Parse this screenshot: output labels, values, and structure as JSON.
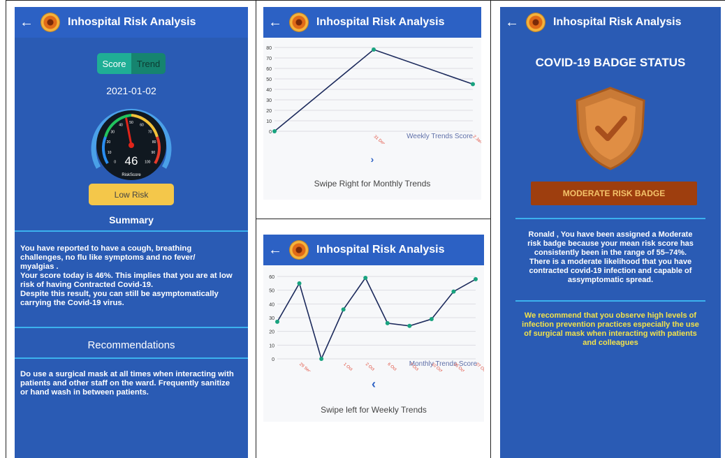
{
  "app_title": "Inhospital Risk Analysis",
  "back_icon": "arrow-left-icon",
  "score_panel": {
    "tabs": [
      "Score",
      "Trend"
    ],
    "date": "2021-01-02",
    "gauge": {
      "value": "46",
      "caption": "RiskScore",
      "max": 100,
      "ticks": [
        "0",
        "10",
        "20",
        "30",
        "40",
        "50",
        "60",
        "70",
        "80",
        "90",
        "100"
      ]
    },
    "risk_label": "Low Risk",
    "summary_title": "Summary",
    "summary_lines": [
      "You have reported to have a cough, breathing",
      "challenges, no flu like symptoms and no fever/",
      "myalgias .",
      "Your score today is 46%. This implies that you are at low",
      "risk of having Contracted Covid-19.",
      "Despite this result, you can still be asymptomatically",
      "carrying the Covid-19 virus."
    ],
    "recommendations_title": "Recommendations",
    "recommendation_lines": [
      "Do use a surgical mask at all times when interacting with",
      "patients and other staff on the ward. Frequently sanitize",
      "or hand wash in between patients."
    ]
  },
  "weekly_panel": {
    "chart_label": "Weekly Trends Score",
    "swipe_hint": "Swipe Right for Monthly Trends",
    "chevron_icon": "chevron-right-icon"
  },
  "monthly_panel": {
    "chart_label": "Monthly Trends Score",
    "swipe_hint": "Swipe left for Weekly Trends",
    "chevron_icon": "chevron-left-icon"
  },
  "badge_panel": {
    "title": "COVID-19 BADGE STATUS",
    "badge_icon": "shield-check-icon",
    "badge_label": "MODERATE RISK BADGE",
    "explanation_lines": [
      "Ronald , You have been assigned a Moderate",
      "risk badge because your mean risk score has",
      "consistently been in the range of 55–74%.",
      "There is a moderate likelihood that you have",
      "contracted covid-19 infection and capable of",
      "assymptomatic spread."
    ],
    "advice_lines": [
      "We recommend that you observe high levels of",
      "infection prevention practices especially the use",
      "of surgical mask when interacting with patients",
      "and colleagues"
    ]
  },
  "colors": {
    "panel_blue": "#2a5bb4",
    "accent_teal": "#1fae95",
    "risk_yellow": "#f4c74a",
    "badge_brown": "#9e3e0e",
    "advice_yellow": "#f2e24a",
    "line_navy": "#1c2a5c",
    "point_green": "#19a37f",
    "xlabel_red": "#e04a3a"
  },
  "chart_data": [
    {
      "type": "line",
      "title": "Weekly Trends Score",
      "x": [
        "",
        "31 Dec",
        "2 Jan"
      ],
      "values": [
        0,
        78,
        45
      ],
      "ylim": [
        0,
        80
      ],
      "yticks": [
        "0",
        "10",
        "20",
        "30",
        "40",
        "50",
        "60",
        "70",
        "80"
      ],
      "grid": true
    },
    {
      "type": "line",
      "title": "Monthly Trends Score",
      "x": [
        "",
        "29 Sep",
        "",
        "1 Oct",
        "2 Oct",
        "6 Oct",
        "7 Oct",
        "10 Oct",
        "25 Oct",
        "27 Oct"
      ],
      "values": [
        27,
        55,
        0,
        36,
        59,
        26,
        24,
        29,
        49,
        58
      ],
      "ylim": [
        0,
        60
      ],
      "yticks": [
        "0",
        "10",
        "20",
        "30",
        "40",
        "50",
        "60"
      ],
      "grid": true
    }
  ]
}
